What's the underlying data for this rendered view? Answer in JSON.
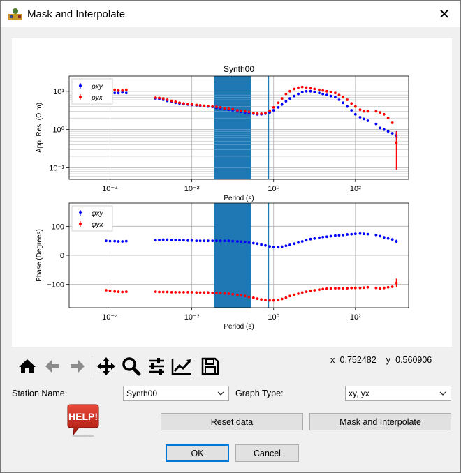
{
  "window": {
    "title": "Mask and Interpolate",
    "close_glyph": "✕"
  },
  "icons": [
    "app-icon",
    "close-icon",
    "home-icon",
    "back-arrow-icon",
    "forward-arrow-icon",
    "pan-icon",
    "zoom-icon",
    "subplots-icon",
    "edit-curve-icon",
    "save-icon",
    "help-icon"
  ],
  "toolbar": {
    "coords": "x=0.752482    y=0.560906"
  },
  "station": {
    "label": "Station Name:",
    "value": "Synth00"
  },
  "graph_type": {
    "label": "Graph Type:",
    "value": "xy, yx"
  },
  "buttons": {
    "reset": "Reset data",
    "mask": "Mask and Interpolate",
    "ok": "OK",
    "cancel": "Cancel"
  },
  "help": {
    "text": "HELP!"
  },
  "colors": {
    "xy": "#0000ff",
    "yx": "#ff0000",
    "mask": "#1f77b4",
    "accent": "#0078d7"
  },
  "chart_data": [
    {
      "type": "scatter",
      "title": "Synth00",
      "xlabel": "Period (s)",
      "ylabel": "App. Res. (Ω.m)",
      "xscale": "log",
      "yscale": "log",
      "xlim": [
        1e-05,
        2000
      ],
      "ylim": [
        0.05,
        25
      ],
      "xticks": [
        "10⁻⁴",
        "10⁻²",
        "10⁰",
        "10²"
      ],
      "yticks": [
        "10⁻¹",
        "10⁰",
        "10¹"
      ],
      "grid": true,
      "legend": "top-left",
      "mask_band": [
        0.035,
        0.28
      ],
      "marker_line": 0.75,
      "series": [
        {
          "name": "ρxy",
          "periods": [
            8e-05,
            0.0001,
            0.00013,
            0.00016,
            0.0002,
            0.00025,
            0.0013,
            0.0016,
            0.002,
            0.0025,
            0.0032,
            0.004,
            0.005,
            0.0063,
            0.008,
            0.01,
            0.013,
            0.016,
            0.02,
            0.025,
            0.032,
            0.04,
            0.05,
            0.063,
            0.08,
            0.1,
            0.13,
            0.16,
            0.2,
            0.25,
            0.32,
            0.4,
            0.5,
            0.63,
            0.8,
            1.0,
            1.3,
            1.6,
            2.0,
            2.5,
            3.2,
            4,
            5,
            6.3,
            8,
            10,
            13,
            16,
            20,
            25,
            32,
            40,
            50,
            63,
            80,
            100,
            130,
            160,
            200,
            320,
            400,
            500,
            630,
            800,
            1000
          ],
          "values": [
            9.5,
            9.2,
            9.0,
            9.0,
            9.3,
            9.0,
            6.5,
            6.3,
            6.0,
            5.6,
            5.4,
            5.0,
            4.8,
            4.6,
            4.5,
            4.4,
            4.3,
            4.2,
            4.1,
            4.0,
            3.9,
            3.7,
            3.6,
            3.4,
            3.3,
            3.2,
            3.0,
            2.9,
            2.8,
            2.7,
            2.6,
            2.5,
            2.5,
            2.6,
            2.8,
            3.2,
            3.8,
            4.5,
            5.5,
            6.5,
            7.5,
            8.5,
            9.5,
            10,
            10,
            9.5,
            9,
            8.5,
            8,
            7.5,
            7,
            6,
            5,
            4,
            3.2,
            2.5,
            2.1,
            1.9,
            1.7,
            1.4,
            1.1,
            1.0,
            0.9,
            0.8,
            0.7
          ]
        },
        {
          "name": "ρyx",
          "periods": [
            8e-05,
            0.0001,
            0.00013,
            0.00016,
            0.0002,
            0.00025,
            0.0013,
            0.0016,
            0.002,
            0.0025,
            0.0032,
            0.004,
            0.005,
            0.0063,
            0.008,
            0.01,
            0.013,
            0.016,
            0.02,
            0.025,
            0.032,
            0.04,
            0.05,
            0.063,
            0.08,
            0.1,
            0.13,
            0.16,
            0.2,
            0.25,
            0.32,
            0.4,
            0.5,
            0.63,
            0.8,
            1.0,
            1.3,
            1.6,
            2.0,
            2.5,
            3.2,
            4,
            5,
            6.3,
            8,
            10,
            13,
            16,
            20,
            25,
            32,
            40,
            50,
            63,
            80,
            100,
            130,
            160,
            200,
            320,
            400,
            500,
            630,
            800,
            1000
          ],
          "values": [
            12,
            11.5,
            11,
            10.5,
            10.5,
            11,
            6.8,
            6.7,
            6.5,
            6.0,
            5.6,
            5.3,
            5.0,
            4.8,
            4.6,
            4.5,
            4.4,
            4.3,
            4.2,
            4.1,
            4.0,
            3.9,
            3.8,
            3.6,
            3.5,
            3.4,
            3.2,
            3.1,
            3.0,
            2.9,
            2.7,
            2.6,
            2.6,
            2.7,
            3.1,
            3.8,
            5.0,
            6.5,
            8.5,
            10,
            11.5,
            12.5,
            13,
            12.5,
            12,
            11.5,
            11,
            10.5,
            10,
            9.5,
            9,
            8,
            7,
            6,
            4.8,
            4.0,
            3.3,
            3.0,
            3.0,
            3.0,
            2.8,
            2.5,
            2.0,
            1.5,
            0.45
          ]
        }
      ]
    },
    {
      "type": "scatter",
      "title": "",
      "xlabel": "Period (s)",
      "ylabel": "Phase (Degrees)",
      "xscale": "log",
      "yscale": "linear",
      "xlim": [
        1e-05,
        2000
      ],
      "ylim": [
        -180,
        180
      ],
      "xticks": [
        "10⁻⁴",
        "10⁻²",
        "10⁰",
        "10²"
      ],
      "yticks": [
        "−100",
        "0",
        "100"
      ],
      "grid": true,
      "legend": "top-left",
      "mask_band": [
        0.035,
        0.28
      ],
      "marker_line": 0.75,
      "series": [
        {
          "name": "φxy",
          "periods": [
            8e-05,
            0.0001,
            0.00013,
            0.00016,
            0.0002,
            0.00025,
            0.0013,
            0.0016,
            0.002,
            0.0025,
            0.0032,
            0.004,
            0.005,
            0.0063,
            0.008,
            0.01,
            0.013,
            0.016,
            0.02,
            0.025,
            0.032,
            0.04,
            0.05,
            0.063,
            0.08,
            0.1,
            0.13,
            0.16,
            0.2,
            0.25,
            0.32,
            0.4,
            0.5,
            0.63,
            0.8,
            1.0,
            1.3,
            1.6,
            2.0,
            2.5,
            3.2,
            4,
            5,
            6.3,
            8,
            10,
            13,
            16,
            20,
            25,
            32,
            40,
            50,
            63,
            80,
            100,
            130,
            160,
            200,
            320,
            400,
            500,
            630,
            800,
            1000
          ],
          "values": [
            50,
            49,
            49,
            48,
            48,
            49,
            52,
            53,
            54,
            54,
            53,
            53,
            52,
            52,
            51,
            51,
            50,
            50,
            50,
            50,
            50,
            50,
            50,
            50,
            50,
            49,
            48,
            47,
            46,
            44,
            42,
            40,
            37,
            34,
            31,
            28,
            28,
            30,
            33,
            36,
            40,
            44,
            48,
            52,
            56,
            58,
            61,
            63,
            64,
            66,
            68,
            69,
            70,
            72,
            73,
            74,
            75,
            74,
            73,
            70,
            66,
            62,
            58,
            55,
            48
          ]
        },
        {
          "name": "φyx",
          "periods": [
            8e-05,
            0.0001,
            0.00013,
            0.00016,
            0.0002,
            0.00025,
            0.0013,
            0.0016,
            0.002,
            0.0025,
            0.0032,
            0.004,
            0.005,
            0.0063,
            0.008,
            0.01,
            0.013,
            0.016,
            0.02,
            0.025,
            0.032,
            0.04,
            0.05,
            0.063,
            0.08,
            0.1,
            0.13,
            0.16,
            0.2,
            0.25,
            0.32,
            0.4,
            0.5,
            0.63,
            0.8,
            1.0,
            1.3,
            1.6,
            2.0,
            2.5,
            3.2,
            4,
            5,
            6.3,
            8,
            10,
            13,
            16,
            20,
            25,
            32,
            40,
            50,
            63,
            80,
            100,
            130,
            160,
            200,
            320,
            400,
            500,
            630,
            800,
            1000
          ],
          "values": [
            -120,
            -122,
            -124,
            -125,
            -126,
            -125,
            -125,
            -126,
            -126,
            -126,
            -127,
            -127,
            -127,
            -127,
            -127,
            -127,
            -128,
            -128,
            -128,
            -128,
            -129,
            -130,
            -130,
            -131,
            -132,
            -134,
            -136,
            -138,
            -140,
            -143,
            -146,
            -149,
            -152,
            -154,
            -155,
            -155,
            -154,
            -150,
            -146,
            -140,
            -136,
            -132,
            -128,
            -125,
            -122,
            -120,
            -118,
            -116,
            -115,
            -114,
            -113,
            -113,
            -113,
            -113,
            -112,
            -112,
            -112,
            -111,
            -110,
            -112,
            -114,
            -112,
            -110,
            -108,
            -95
          ]
        }
      ]
    }
  ]
}
